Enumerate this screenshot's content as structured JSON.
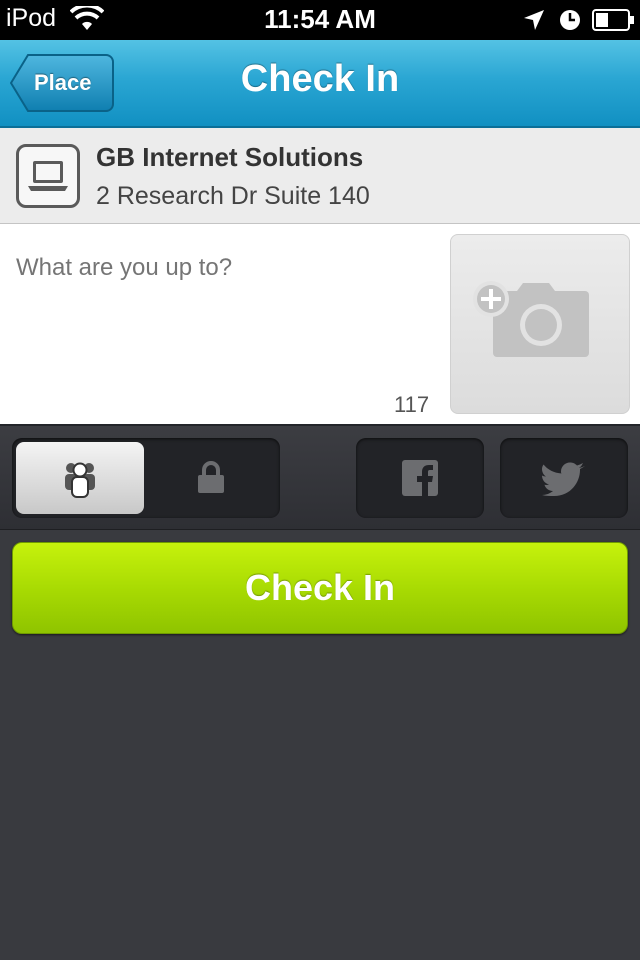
{
  "status_bar": {
    "carrier": "iPod",
    "time": "11:54 AM"
  },
  "nav": {
    "title": "Check In",
    "back_label": "Place"
  },
  "place": {
    "icon": "laptop-icon",
    "name": "GB Internet Solutions",
    "address": "2 Research Dr Suite 140"
  },
  "compose": {
    "placeholder": "What are you up to?",
    "char_count": "117",
    "photo_icon": "add-photo-camera-icon"
  },
  "share": {
    "visibility_options": [
      "friends-icon",
      "lock-icon"
    ],
    "selected": "friends",
    "networks": [
      "facebook-icon",
      "twitter-icon"
    ]
  },
  "checkin_button": {
    "label": "Check In",
    "color": "#a6d902"
  },
  "colors": {
    "nav": "#2aa6d3",
    "background": "#393a3f"
  }
}
